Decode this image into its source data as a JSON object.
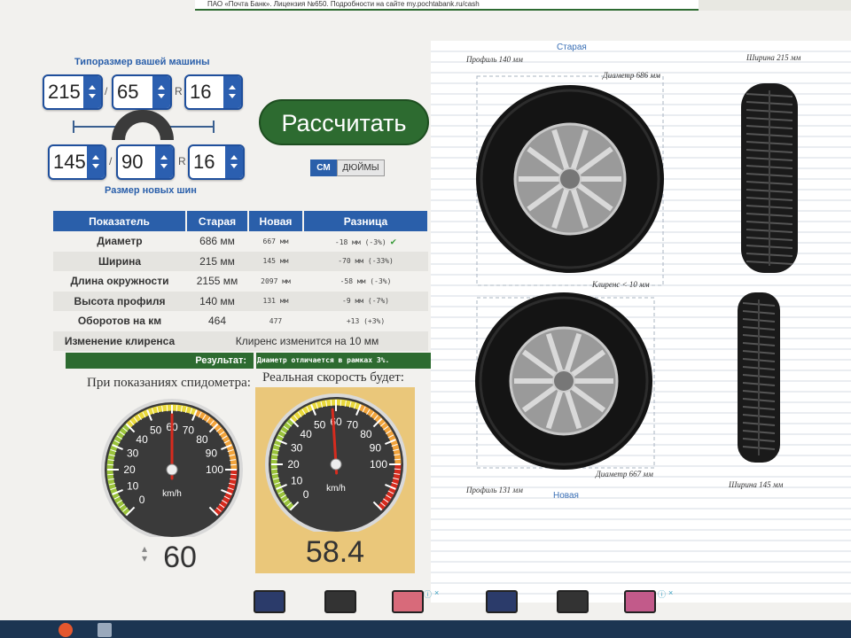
{
  "banner": {
    "text": "ПАО «Почта Банк». Лицензия №650. Подробности на сайте my.pochtabank.ru/cash"
  },
  "calculator": {
    "current_title": "Типоразмер вашей машины",
    "new_title": "Размер новых шин",
    "current": {
      "width": "215",
      "profile": "65",
      "radius": "16"
    },
    "new": {
      "width": "145",
      "profile": "90",
      "radius": "16"
    },
    "sep_slash": "/",
    "sep_r": "R",
    "calculate_label": "Рассчитать",
    "units": {
      "cm": "СМ",
      "inches": "ДЮЙМЫ",
      "selected": "cm"
    }
  },
  "table": {
    "headers": [
      "Показатель",
      "Старая",
      "Новая",
      "Разница"
    ],
    "rows": [
      {
        "label": "Диаметр",
        "old": "686 мм",
        "new": "667 мм",
        "diff": "-18 мм (-3%)",
        "ok": true
      },
      {
        "label": "Ширина",
        "old": "215 мм",
        "new": "145 мм",
        "diff": "-70 мм (-33%)"
      },
      {
        "label": "Длина окружности",
        "old": "2155 мм",
        "new": "2097 мм",
        "diff": "-58 мм (-3%)"
      },
      {
        "label": "Высота профиля",
        "old": "140 мм",
        "new": "131 мм",
        "diff": "-9 мм (-7%)"
      },
      {
        "label": "Оборотов на км",
        "old": "464",
        "new": "477",
        "diff": "+13 (+3%)"
      }
    ],
    "clearance": {
      "label": "Изменение клиренса",
      "value": "Клиренс изменится на 10 мм"
    }
  },
  "result": {
    "label": "Результат:",
    "value": "Диаметр отличается в рамках 3%."
  },
  "speedometer": {
    "left_caption": "При показаниях спидометра:",
    "right_caption": "Реальная скорость будет:",
    "unit": "km/h",
    "max": 120,
    "ticks": [
      "0",
      "10",
      "20",
      "30",
      "40",
      "50",
      "60",
      "70",
      "80",
      "90",
      "100"
    ],
    "input_speed": "60",
    "real_speed": "58.4",
    "input_value": 60,
    "real_value": 58.4,
    "colors": {
      "needle": "#d62b1e",
      "panel": "#eac77a",
      "face": "#3a3a3a"
    }
  },
  "diagram": {
    "old_title": "Старая",
    "new_title": "Новая",
    "old_profile": "Профиль 140 мм",
    "old_diameter": "Диаметр 686 мм",
    "old_width": "Ширина 215 мм",
    "clearance": "Клиренс < 10 мм",
    "new_profile": "Профиль 131 мм",
    "new_diameter": "Диаметр 667 мм",
    "new_width": "Ширина 145 мм"
  },
  "ads": {
    "close_icon": "×",
    "info_icon": "ⓘ"
  }
}
